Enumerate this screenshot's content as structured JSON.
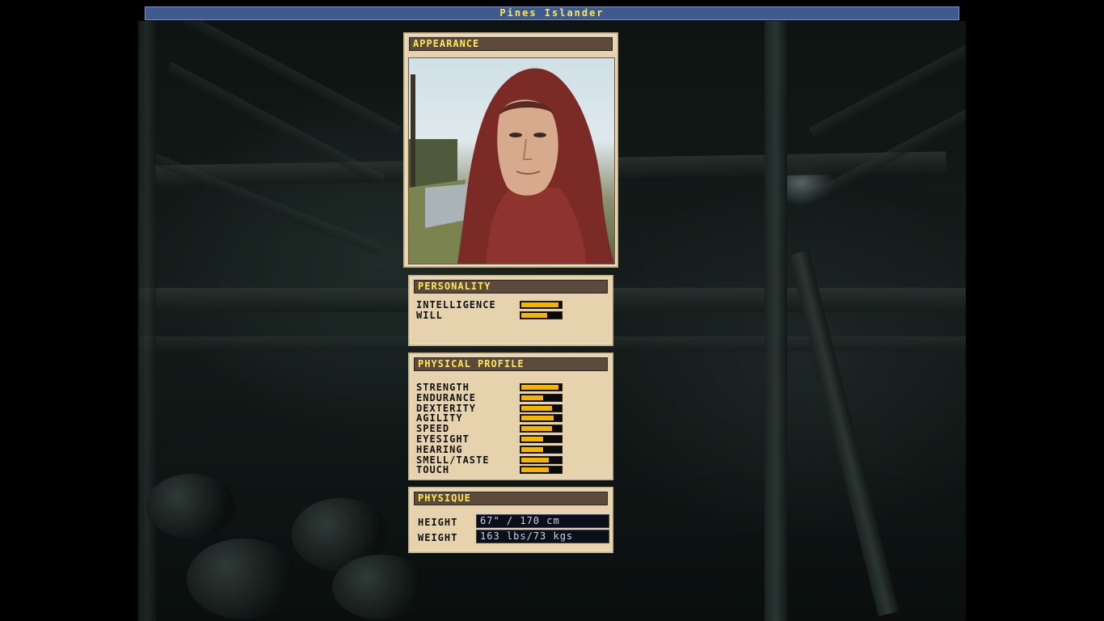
{
  "window": {
    "title": "Pines Islander"
  },
  "appearance": {
    "heading": "APPEARANCE"
  },
  "personality": {
    "heading": "PERSONALITY",
    "stats": [
      {
        "label": "INTELLIGENCE",
        "level": 0.94
      },
      {
        "label": "WILL",
        "level": 0.65
      }
    ]
  },
  "physical_profile": {
    "heading": "PHYSICAL PROFILE",
    "stats": [
      {
        "label": "STRENGTH",
        "level": 0.94
      },
      {
        "label": "ENDURANCE",
        "level": 0.55
      },
      {
        "label": "DEXTERITY",
        "level": 0.78
      },
      {
        "label": "AGILITY",
        "level": 0.82
      },
      {
        "label": "SPEED",
        "level": 0.78
      },
      {
        "label": "EYESIGHT",
        "level": 0.55
      },
      {
        "label": "HEARING",
        "level": 0.55
      },
      {
        "label": "SMELL/TASTE",
        "level": 0.7
      },
      {
        "label": "TOUCH",
        "level": 0.7
      }
    ]
  },
  "physique": {
    "heading": "PHYSIQUE",
    "height_label": "HEIGHT",
    "height_value": "67\" / 170 cm",
    "weight_label": "WEIGHT",
    "weight_value": "163 lbs/73 kgs"
  },
  "colors": {
    "bar_fill": "#f5b400",
    "title_text": "#ffe94a",
    "title_bg": "#3e5a8e",
    "panel_bg": "#e6d3ae"
  }
}
